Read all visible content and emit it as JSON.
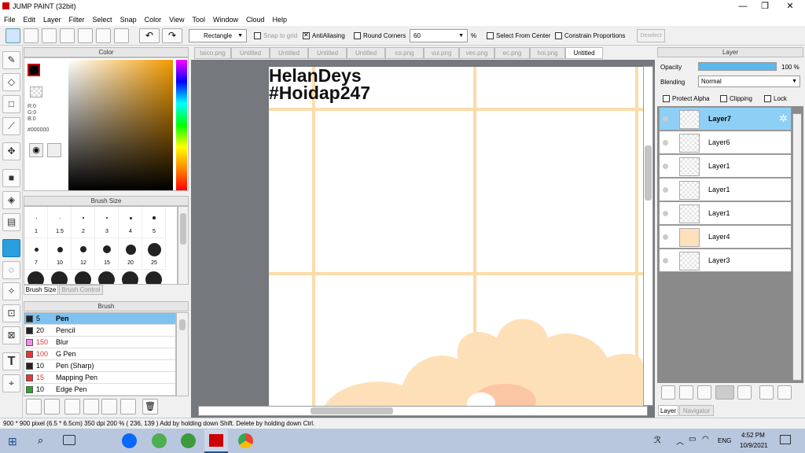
{
  "window": {
    "title": "JUMP PAINT (32bit)",
    "min": "—",
    "max": "❐",
    "close": "✕"
  },
  "menu": [
    "File",
    "Edit",
    "Layer",
    "Filter",
    "Select",
    "Snap",
    "Color",
    "View",
    "Tool",
    "Window",
    "Cloud",
    "Help"
  ],
  "toolbar": {
    "shape": "Rectangle",
    "snap_to_grid": "Snap to grid",
    "antialiasing": "AntiAliasing",
    "round_corners": "Round Corners",
    "corner_value": "60",
    "percent": "%",
    "select_from_center": "Select From Center",
    "constrain": "Constrain Proportions",
    "deselect": "Deselect"
  },
  "color_panel": {
    "title": "Color",
    "r": "R:0",
    "g": "G:0",
    "b": "B:0",
    "hex": "#000000"
  },
  "brush_size_panel": {
    "title": "Brush Size",
    "sizes": [
      "1",
      "1.5",
      "2",
      "3",
      "4",
      "5",
      "7",
      "10",
      "12",
      "15",
      "20",
      "25"
    ],
    "tab_active": "Brush Size",
    "tab_other": "Brush Control"
  },
  "brush_panel": {
    "title": "Brush",
    "items": [
      {
        "size": "5",
        "name": "Pen",
        "color": "#222222"
      },
      {
        "size": "20",
        "name": "Pencil",
        "color": "#222222"
      },
      {
        "size": "150",
        "name": "Blur",
        "color": "#ff88ee"
      },
      {
        "size": "100",
        "name": "G Pen",
        "color": "#ee3333"
      },
      {
        "size": "10",
        "name": "Pen (Sharp)",
        "color": "#222222"
      },
      {
        "size": "15",
        "name": "Mapping Pen",
        "color": "#ee3333"
      },
      {
        "size": "10",
        "name": "Edge Pen",
        "color": "#22aa22"
      }
    ]
  },
  "tabs": [
    "taico.png",
    "Untitled",
    "Untitled",
    "Untitled",
    "Untitled",
    "co.png",
    "vui.png",
    "ves.png",
    "ec.png",
    "hoi.png",
    "Untitled"
  ],
  "canvas": {
    "line1": "HelanDeys",
    "line2": "#Hoidap247"
  },
  "layer_panel": {
    "title": "Layer",
    "opacity_label": "Opacity",
    "opacity_value": "100 %",
    "opacity": 1.0,
    "blending_label": "Blending",
    "blending_value": "Normal",
    "protect_alpha": "Protect Alpha",
    "clipping": "Clipping",
    "lock": "Lock",
    "layers": [
      "Layer7",
      "Layer6",
      "Layer1",
      "Layer1",
      "Layer1",
      "Layer4",
      "Layer3"
    ],
    "tab_layer": "Layer",
    "tab_navigator": "Navigator"
  },
  "status": {
    "text": "900 * 900 pixel   (6.5 * 6.5cm)   350 dpi   200 %   ( 236, 139 )   Add by holding down Shift. Delete by holding down Ctrl."
  },
  "taskbar": {
    "time": "4:52 PM",
    "date": "10/9/2021",
    "lang": "ENG"
  }
}
